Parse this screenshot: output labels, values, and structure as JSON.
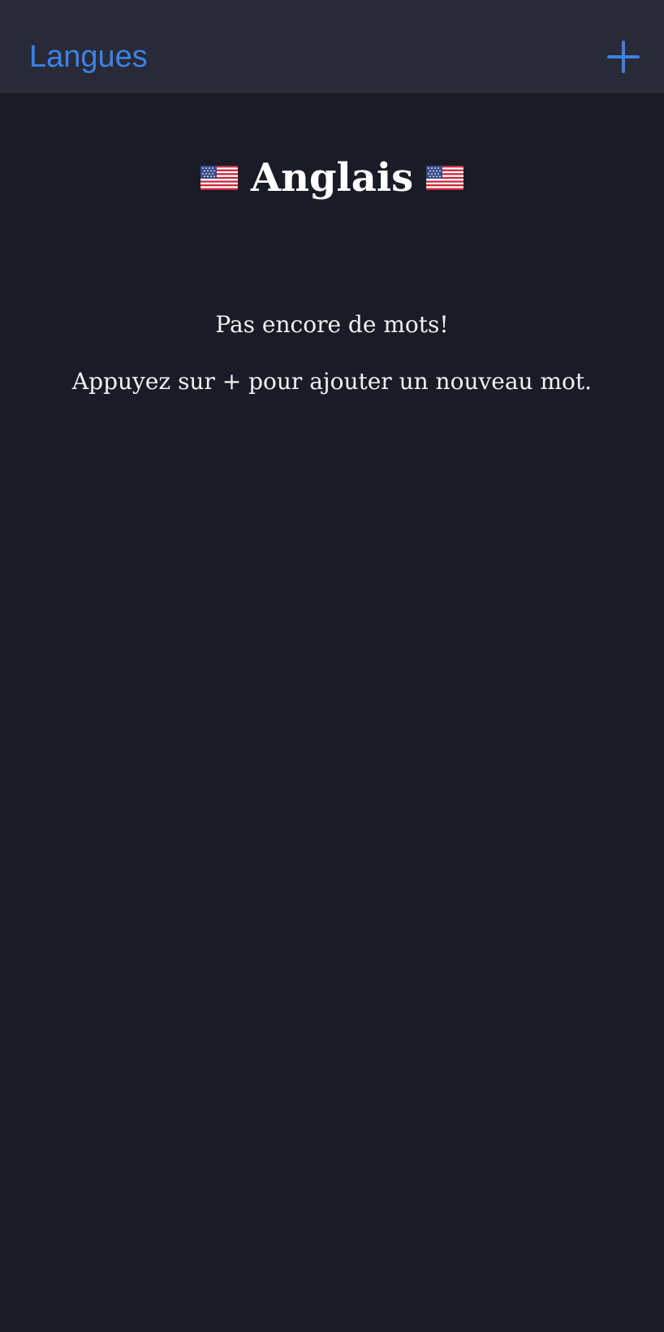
{
  "nav": {
    "back_label": "Langues",
    "add_icon": "plus-icon",
    "accent_color": "#3b82e6",
    "background_color": "#282a37"
  },
  "header": {
    "title": "Anglais",
    "flag_icon": "us-flag-icon"
  },
  "empty_state": {
    "line1": "Pas encore de mots!",
    "line2": "Appuyez sur + pour ajouter un nouveau mot."
  },
  "colors": {
    "page_background": "#191b26",
    "text": "#ffffff"
  }
}
